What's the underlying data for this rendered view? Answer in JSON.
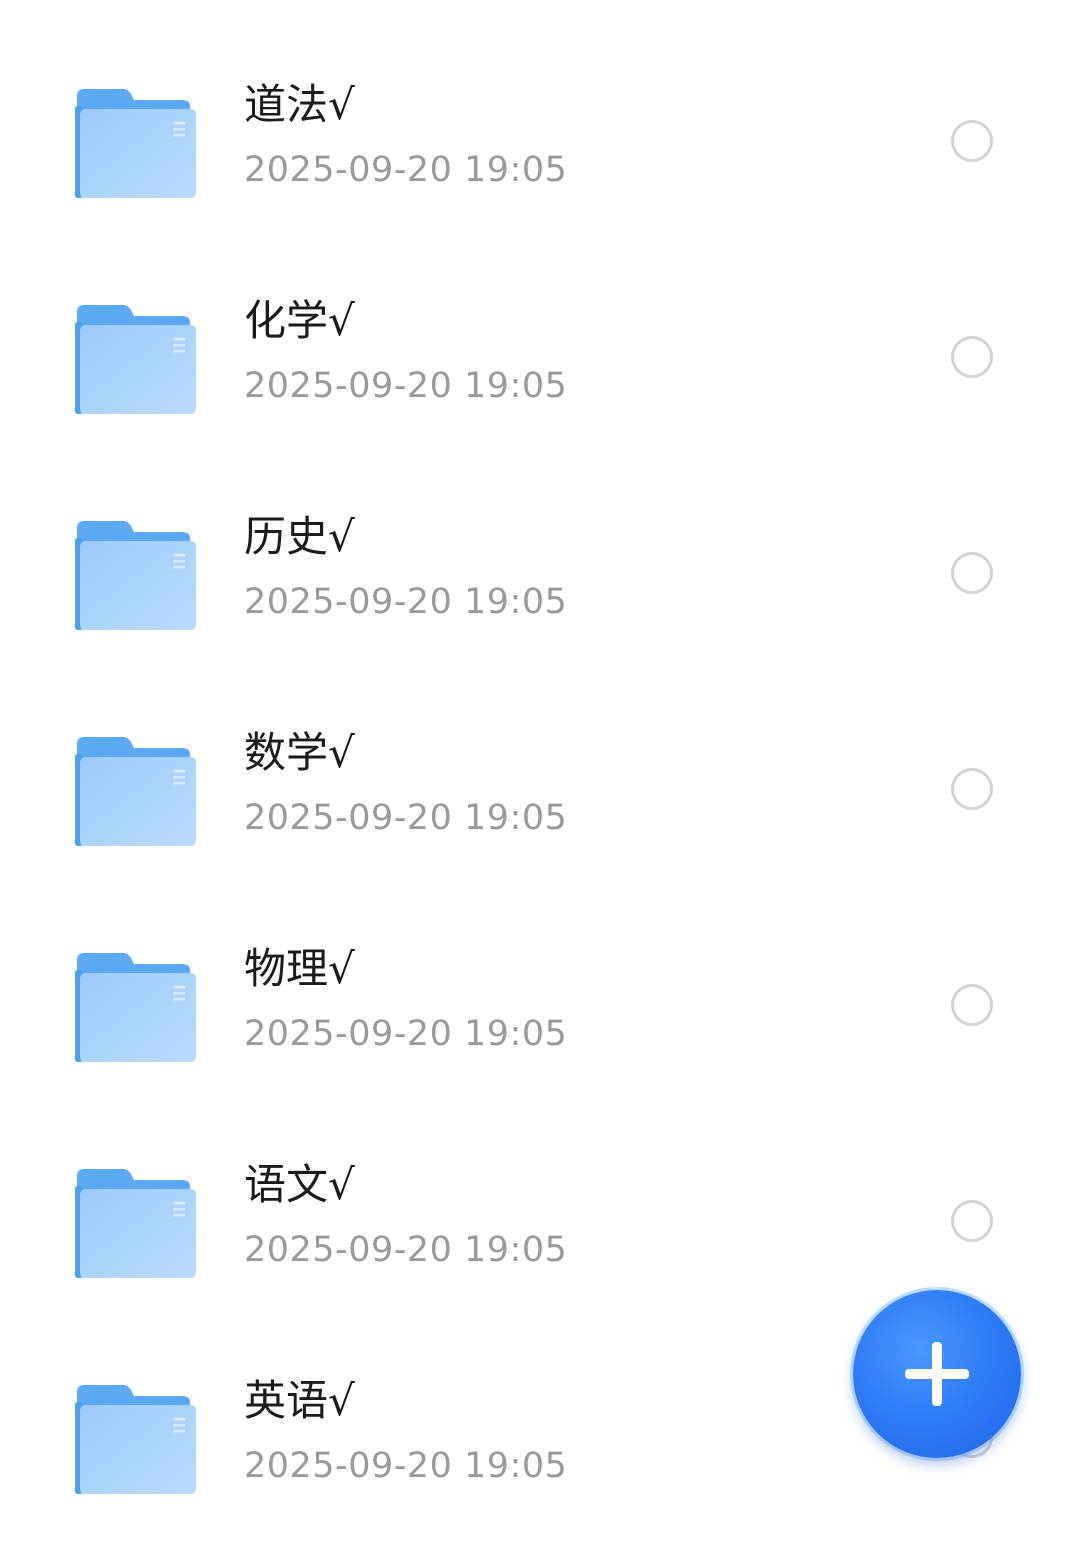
{
  "files": [
    {
      "name": "道法√",
      "time": "2025-09-20 19:05"
    },
    {
      "name": "化学√",
      "time": "2025-09-20 19:05"
    },
    {
      "name": "历史√",
      "time": "2025-09-20 19:05"
    },
    {
      "name": "数学√",
      "time": "2025-09-20 19:05"
    },
    {
      "name": "物理√",
      "time": "2025-09-20 19:05"
    },
    {
      "name": "语文√",
      "time": "2025-09-20 19:05"
    },
    {
      "name": "英语√",
      "time": "2025-09-20 19:05"
    }
  ],
  "icons": {
    "folder": "folder-icon",
    "select": "radio-unchecked-icon",
    "add": "plus-icon"
  },
  "colors": {
    "folder_back": "#5aa9f2",
    "folder_front": "#a9d3fb",
    "fab": "#2f7df7",
    "radio_border": "#d2d2d2"
  }
}
